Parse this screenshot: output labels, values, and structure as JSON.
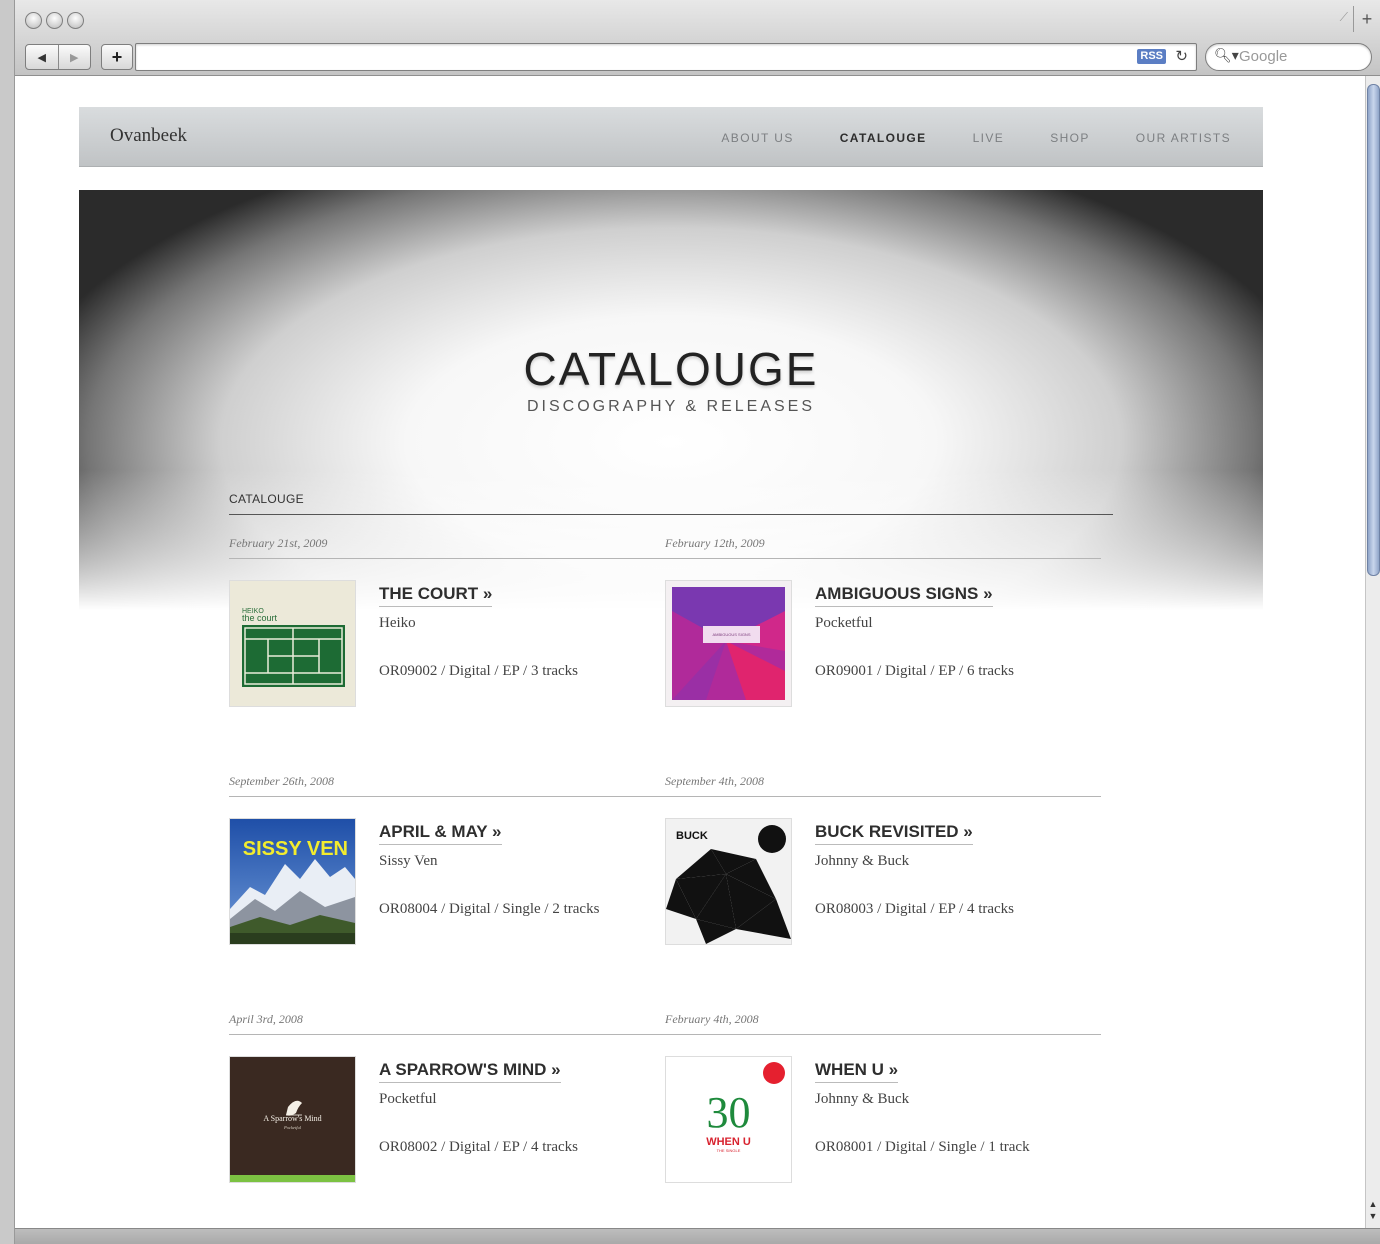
{
  "browser": {
    "search_placeholder": "Google",
    "rss_label": "RSS"
  },
  "site": {
    "logo": "Ovanbeek",
    "menu": [
      "ABOUT US",
      "CATALOUGE",
      "LIVE",
      "SHOP",
      "OUR ARTISTS"
    ],
    "active_menu": "CATALOUGE"
  },
  "hero": {
    "title": "CATALOUGE",
    "subtitle": "DISCOGRAPHY & RELEASES"
  },
  "section_title": "CATALOUGE",
  "releases": [
    {
      "date": "February 21st, 2009",
      "title": "THE COURT »",
      "artist": "Heiko",
      "meta": "OR09002 / Digital / EP / 3 tracks",
      "cover": "the-court",
      "cover_text": "the court"
    },
    {
      "date": "February 12th, 2009",
      "title": "AMBIGUOUS SIGNS »",
      "artist": "Pocketful",
      "meta": "OR09001 / Digital / EP / 6 tracks",
      "cover": "ambiguous-signs",
      "cover_text": "AMBIGUOUS SIGNS"
    },
    {
      "date": "September 26th, 2008",
      "title": "APRIL & MAY »",
      "artist": "Sissy Ven",
      "meta": "OR08004 / Digital / Single / 2 tracks",
      "cover": "april-may",
      "cover_text": "SISSY VEN"
    },
    {
      "date": "September 4th, 2008",
      "title": "BUCK REVISITED »",
      "artist": "Johnny & Buck",
      "meta": "OR08003 / Digital / EP / 4 tracks",
      "cover": "buck-revisited",
      "cover_text": "BUCK"
    },
    {
      "date": "April 3rd, 2008",
      "title": "A SPARROW'S MIND »",
      "artist": "Pocketful",
      "meta": "OR08002 / Digital / EP / 4 tracks",
      "cover": "sparrows-mind",
      "cover_text": "A Sparrow's Mind"
    },
    {
      "date": "February 4th, 2008",
      "title": "WHEN U »",
      "artist": "Johnny & Buck",
      "meta": "OR08001 / Digital / Single / 1 track",
      "cover": "when-u",
      "cover_text": "WHEN U",
      "cover_number": "30"
    }
  ]
}
